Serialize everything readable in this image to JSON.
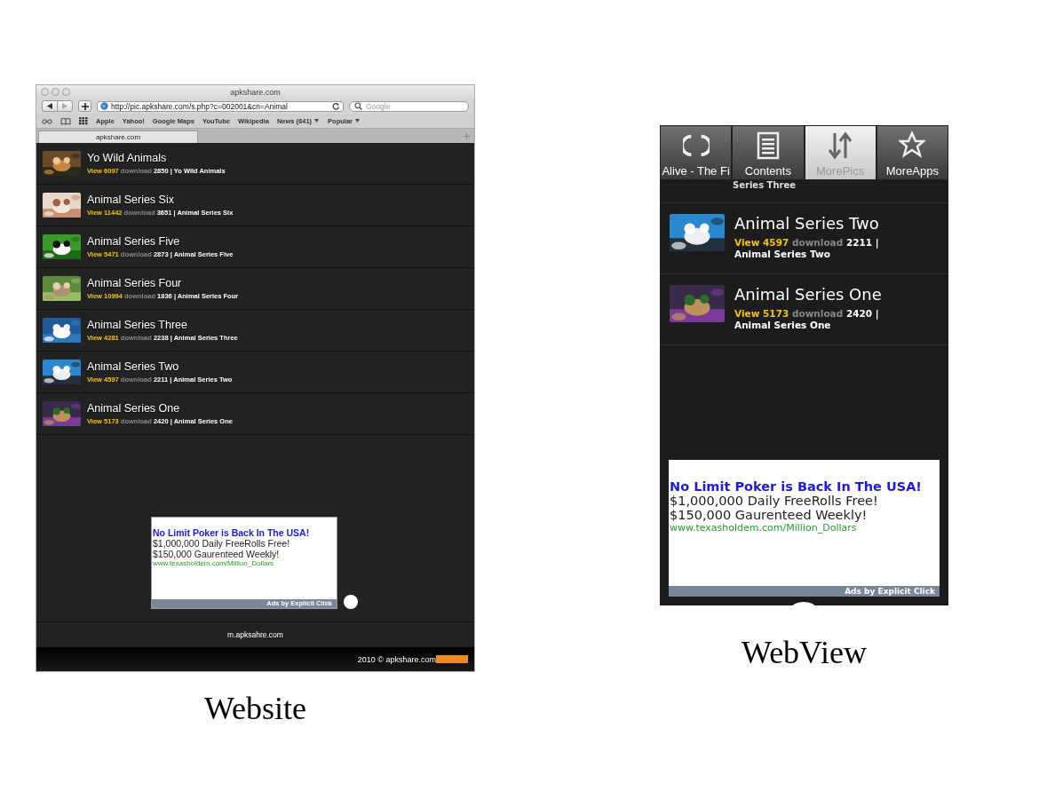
{
  "website": {
    "window_title": "apkshare.com",
    "address": "http://pic.apkshare.com/s.php?c=002001&cn=Animal",
    "search": {
      "placeholder": "Google"
    },
    "bookmarks": [
      {
        "label": "Apple",
        "menu": false
      },
      {
        "label": "Yahoo!",
        "menu": false
      },
      {
        "label": "Google Maps",
        "menu": false
      },
      {
        "label": "YouTube",
        "menu": false
      },
      {
        "label": "Wikipedia",
        "menu": false
      },
      {
        "label": "News (841)",
        "menu": true
      },
      {
        "label": "Popular",
        "menu": true
      }
    ],
    "tab": "apkshare.com",
    "items": [
      {
        "title": "Yo Wild Animals",
        "views": "View 6097",
        "download_label": "download",
        "downloads": "2850",
        "separator": "|",
        "series": "Yo Wild Animals"
      },
      {
        "title": "Animal Series Six",
        "views": "View 11442",
        "download_label": "download",
        "downloads": "3651",
        "separator": "|",
        "series": "Animal Series Six"
      },
      {
        "title": "Animal Series Five",
        "views": "View 5471",
        "download_label": "download",
        "downloads": "2873",
        "separator": "|",
        "series": "Animal Series Five"
      },
      {
        "title": "Animal Series Four",
        "views": "View 10994",
        "download_label": "download",
        "downloads": "1836",
        "separator": "|",
        "series": "Animal Series Four"
      },
      {
        "title": "Animal Series Three",
        "views": "View 4281",
        "download_label": "download",
        "downloads": "2238",
        "separator": "|",
        "series": "Animal Series Three"
      },
      {
        "title": "Animal Series Two",
        "views": "View 4597",
        "download_label": "download",
        "downloads": "2211",
        "separator": "|",
        "series": "Animal Series Two"
      },
      {
        "title": "Animal Series One",
        "views": "View 5173",
        "download_label": "download",
        "downloads": "2420",
        "separator": "|",
        "series": "Animal Series One"
      }
    ],
    "ad": {
      "headline": "No Limit Poker is Back In The USA!",
      "lines": [
        "$1,000,000 Daily FreeRolls Free!",
        "$150,000 Gaurenteed Weekly!"
      ],
      "url": "www.texasholdem.com/Million_Dollars",
      "footer": "Ads by Explicit Click"
    },
    "footer_link": "m.apksahre.com",
    "copyright": "2010 © apkshare.com",
    "caption": "Website"
  },
  "webview": {
    "tabs": [
      {
        "label": "Alive - The Fi",
        "selected": false
      },
      {
        "label": "Contents",
        "selected": false
      },
      {
        "label": "MorePics",
        "selected": true
      },
      {
        "label": "MoreApps",
        "selected": false
      }
    ],
    "partial_row": "Series Three",
    "items": [
      {
        "title": "Animal Series Two",
        "views": "View 4597",
        "download_label": "download",
        "downloads": "2211",
        "separator": "|",
        "series": "Animal Series Two"
      },
      {
        "title": "Animal Series One",
        "views": "View 5173",
        "download_label": "download",
        "downloads": "2420",
        "separator": "|",
        "series": "Animal Series One"
      }
    ],
    "ad": {
      "headline": "No Limit Poker is Back In The USA!",
      "lines": [
        "$1,000,000 Daily FreeRolls Free!",
        "$150,000 Gaurenteed Weekly!"
      ],
      "url": "www.texasholdem.com/Million_Dollars",
      "footer": "Ads by Explicit Click"
    },
    "caption": "WebView"
  }
}
